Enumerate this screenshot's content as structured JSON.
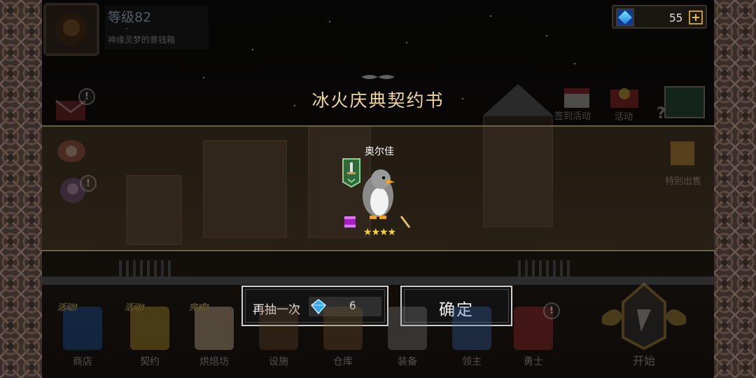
{
  "player": {
    "level": "等级82",
    "title": "神缘灵梦的意钱箱"
  },
  "gems": {
    "count": "55",
    "plus": "+"
  },
  "side_menu": {
    "checkin_label": "签到活动",
    "event_label": "活动",
    "special_label": "特别出售",
    "notice_mark": "!",
    "help_mark": "?"
  },
  "dialog": {
    "title": "冰火庆典契约书",
    "hero": {
      "name": "奥尔佳",
      "stars": "★★★★",
      "star_count": 4
    }
  },
  "buttons": {
    "redraw_label": "再抽一次",
    "redraw_cost": "6",
    "confirm_label": "确定"
  },
  "bottom_menu": [
    {
      "label": "商店",
      "tag": "活动!"
    },
    {
      "label": "契约",
      "tag": "活动!"
    },
    {
      "label": "烘焙坊",
      "tag": "完成!"
    },
    {
      "label": "设施",
      "tag": ""
    },
    {
      "label": "仓库",
      "tag": ""
    },
    {
      "label": "装备",
      "tag": ""
    },
    {
      "label": "领主",
      "tag": ""
    },
    {
      "label": "勇士",
      "tag": ""
    }
  ],
  "start": {
    "label": "开始"
  },
  "colors": {
    "title_gold": "#f0d79a",
    "star_yellow": "#f5d23c",
    "gem_blue": "#1e7bd9",
    "button_border": "#cfcfcf"
  }
}
